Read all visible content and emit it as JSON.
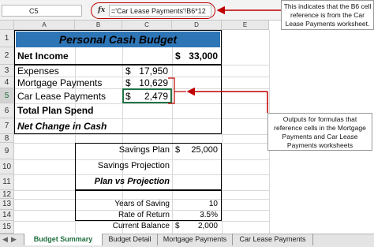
{
  "formula_bar": {
    "cell_ref": "C5",
    "fx": "fx",
    "formula": "='Car Lease Payments'!B6*12"
  },
  "callouts": {
    "formula_note": "This indicates that the B6 cell reference is from the Car Lease Payments worksheet.",
    "outputs_note": "Outputs for formulas that reference cells in the Mortgage Payments and Car Lease Payments worksheets"
  },
  "columns": [
    "A",
    "B",
    "C",
    "D",
    "E"
  ],
  "rows": [
    "1",
    "2",
    "3",
    "4",
    "5",
    "6",
    "7",
    "8",
    "9",
    "10",
    "11",
    "12",
    "13",
    "14",
    "15"
  ],
  "sheet": {
    "title": "Personal Cash Budget",
    "net_income_label": "Net Income",
    "net_income_cur": "$",
    "net_income_val": "33,000",
    "expenses_label": "Expenses",
    "expenses_cur": "$",
    "expenses_val": "17,950",
    "mortgage_label": "Mortgage Payments",
    "mortgage_cur": "$",
    "mortgage_val": "10,629",
    "car_label": "Car Lease Payments",
    "car_cur": "$",
    "car_val": "2,479",
    "total_label": "Total Plan Spend",
    "net_change_label": "Net Change in Cash",
    "savings_plan_label": "Savings Plan",
    "savings_plan_cur": "$",
    "savings_plan_val": "25,000",
    "savings_proj_label": "Savings Projection",
    "plan_vs_proj_label": "Plan vs Projection",
    "years_label": "Years of Saving",
    "years_val": "10",
    "rate_label": "Rate of Return",
    "rate_val": "3.5%",
    "balance_label": "Current Balance",
    "balance_cur": "$",
    "balance_val": "2,000"
  },
  "tabs": [
    "Budget Summary",
    "Budget Detail",
    "Mortgage Payments",
    "Car Lease Payments"
  ],
  "colors": {
    "title_fill": "#2e75b6",
    "accent": "#c00000",
    "selected": "#217346"
  }
}
